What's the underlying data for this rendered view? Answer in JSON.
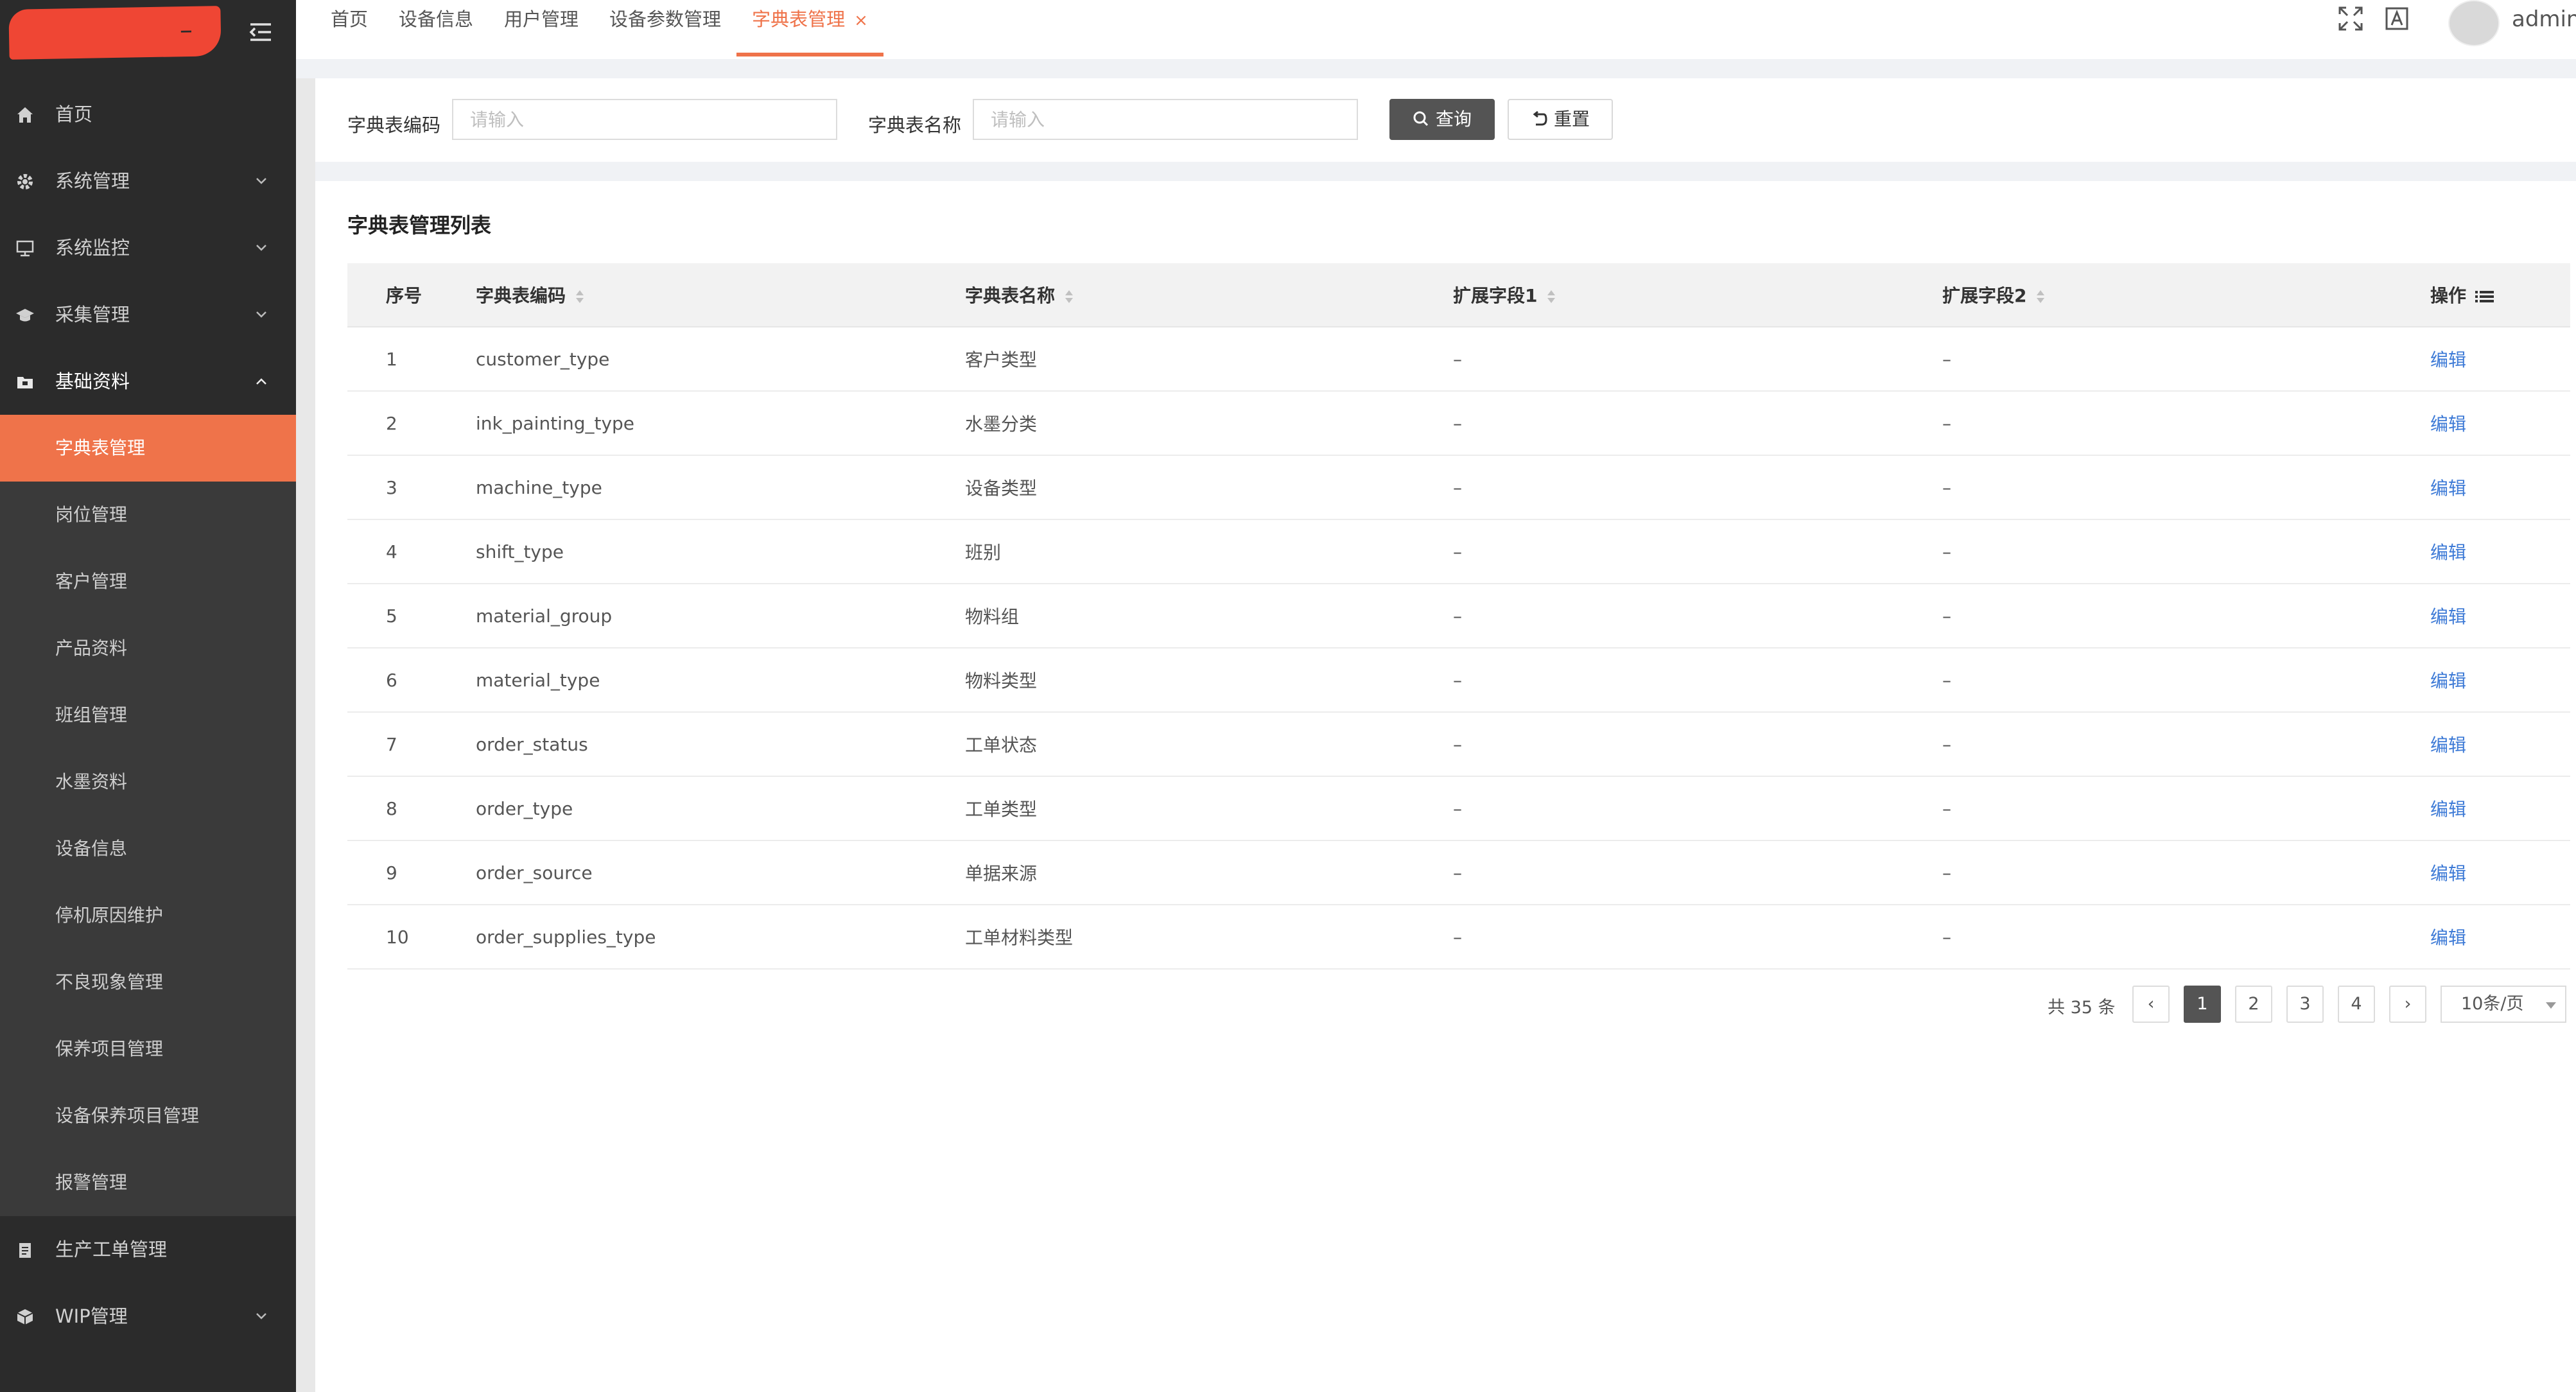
{
  "sidebar": {
    "logo_text": "–",
    "menu": [
      {
        "label": "首页",
        "icon": "home-icon"
      },
      {
        "label": "系统管理",
        "icon": "gear-icon"
      },
      {
        "label": "系统监控",
        "icon": "monitor-icon"
      },
      {
        "label": "采集管理",
        "icon": "graduation-cap-icon"
      },
      {
        "label": "基础资料",
        "icon": "folder-icon"
      }
    ],
    "submenu": [
      "字典表管理",
      "岗位管理",
      "客户管理",
      "产品资料",
      "班组管理",
      "水墨资料",
      "设备信息",
      "停机原因维护",
      "不良现象管理",
      "保养项目管理",
      "设备保养项目管理",
      "报警管理"
    ],
    "menu_after": [
      {
        "label": "生产工单管理",
        "icon": "clipboard-icon"
      },
      {
        "label": "WIP管理",
        "icon": "cube-icon"
      }
    ],
    "active_color": "#ef734a",
    "bg_color": "#2b2b2b"
  },
  "tabs": [
    {
      "label": "首页"
    },
    {
      "label": "设备信息"
    },
    {
      "label": "用户管理"
    },
    {
      "label": "设备参数管理"
    },
    {
      "label": "字典表管理",
      "close": "×"
    }
  ],
  "user": {
    "name": "admin"
  },
  "search": {
    "code_label": "字典表编码",
    "code_placeholder": "请输入",
    "name_label": "字典表名称",
    "name_placeholder": "请输入",
    "query_label": "查询",
    "reset_label": "重置"
  },
  "list": {
    "title": "字典表管理列表",
    "columns": [
      "序号",
      "字典表编码",
      "字典表名称",
      "扩展字段1",
      "扩展字段2",
      "操作"
    ],
    "rows": [
      {
        "no": "1",
        "code": "customer_type",
        "name": "客户类型",
        "ext1": "–",
        "ext2": "–",
        "action": "编辑"
      },
      {
        "no": "2",
        "code": "ink_painting_type",
        "name": "水墨分类",
        "ext1": "–",
        "ext2": "–",
        "action": "编辑"
      },
      {
        "no": "3",
        "code": "machine_type",
        "name": "设备类型",
        "ext1": "–",
        "ext2": "–",
        "action": "编辑"
      },
      {
        "no": "4",
        "code": "shift_type",
        "name": "班别",
        "ext1": "–",
        "ext2": "–",
        "action": "编辑"
      },
      {
        "no": "5",
        "code": "material_group",
        "name": "物料组",
        "ext1": "–",
        "ext2": "–",
        "action": "编辑"
      },
      {
        "no": "6",
        "code": "material_type",
        "name": "物料类型",
        "ext1": "–",
        "ext2": "–",
        "action": "编辑"
      },
      {
        "no": "7",
        "code": "order_status",
        "name": "工单状态",
        "ext1": "–",
        "ext2": "–",
        "action": "编辑"
      },
      {
        "no": "8",
        "code": "order_type",
        "name": "工单类型",
        "ext1": "–",
        "ext2": "–",
        "action": "编辑"
      },
      {
        "no": "9",
        "code": "order_source",
        "name": "单据来源",
        "ext1": "–",
        "ext2": "–",
        "action": "编辑"
      },
      {
        "no": "10",
        "code": "order_supplies_type",
        "name": "工单材料类型",
        "ext1": "–",
        "ext2": "–",
        "action": "编辑"
      }
    ]
  },
  "pagination": {
    "total_text": "共 35 条",
    "prev": "‹",
    "pages": [
      "1",
      "2",
      "3",
      "4"
    ],
    "current": "1",
    "next": "›",
    "page_size": "10条/页"
  }
}
